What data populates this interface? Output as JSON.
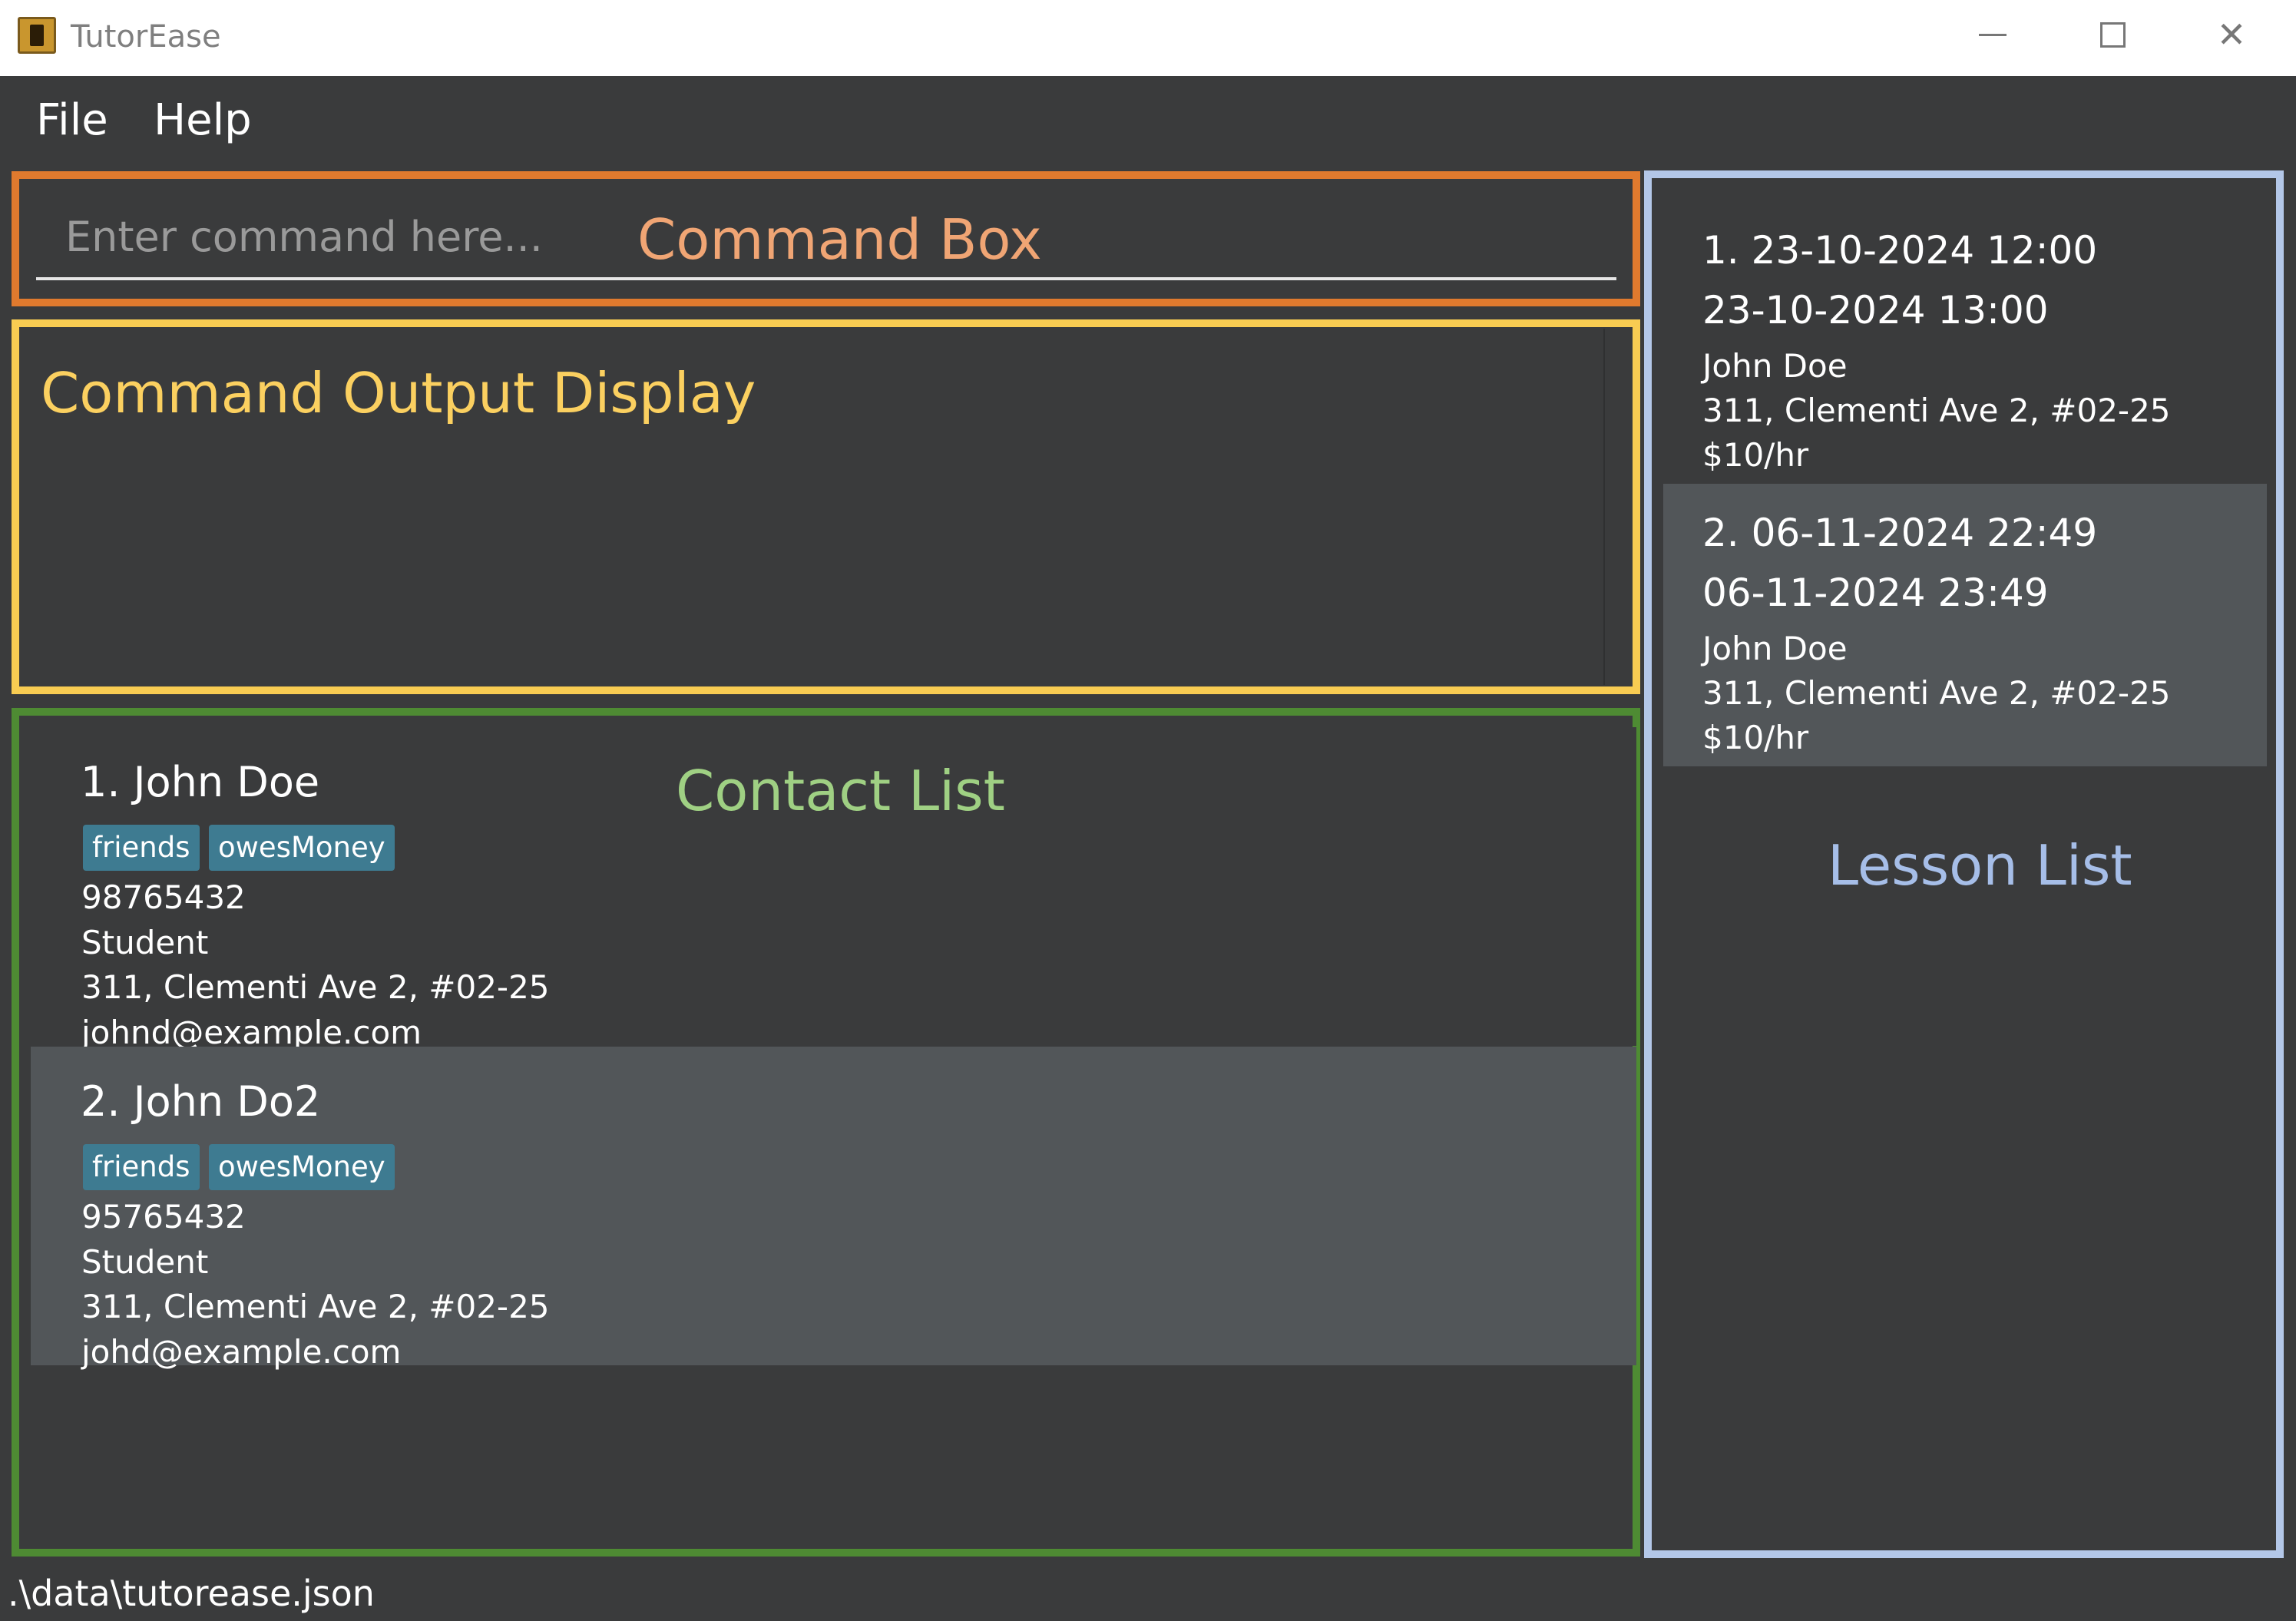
{
  "window": {
    "title": "TutorEase",
    "controls": {
      "minimize": "minimize-icon",
      "maximize": "maximize-icon",
      "close": "close-icon"
    }
  },
  "menu": {
    "items": [
      {
        "label": "File"
      },
      {
        "label": "Help"
      }
    ]
  },
  "command_box": {
    "placeholder": "Enter command here...",
    "value": "",
    "annotation": "Command Box"
  },
  "output_display": {
    "text": "",
    "annotation": "Command Output Display"
  },
  "contact_list": {
    "annotation": "Contact List",
    "contacts": [
      {
        "name": "1. John Doe",
        "tags": [
          "friends",
          "owesMoney"
        ],
        "phone": "98765432",
        "role": "Student",
        "address": "311, Clementi Ave 2, #02-25",
        "email": "johnd@example.com"
      },
      {
        "name": "2. John Do2",
        "tags": [
          "friends",
          "owesMoney"
        ],
        "phone": "95765432",
        "role": "Student",
        "address": "311, Clementi Ave 2, #02-25",
        "email": "johd@example.com"
      }
    ]
  },
  "lesson_list": {
    "annotation": "Lesson List",
    "lessons": [
      {
        "start": "1. 23-10-2024 12:00",
        "end": "23-10-2024 13:00",
        "student": "John Doe",
        "address": "311, Clementi Ave 2, #02-25",
        "rate": "$10/hr"
      },
      {
        "start": "2. 06-11-2024 22:49",
        "end": "06-11-2024 23:49",
        "student": "John Doe",
        "address": "311, Clementi Ave 2, #02-25",
        "rate": "$10/hr"
      }
    ]
  },
  "status_bar": {
    "path": ".\\data\\tutorease.json"
  },
  "colors": {
    "background": "#3a3b3c",
    "selected_row": "#525659",
    "tag": "#3e7b91",
    "command_box_border": "#e07a2e",
    "output_border": "#f8cc52",
    "contact_border": "#4e8b33",
    "lesson_border": "#b3c7e8"
  }
}
